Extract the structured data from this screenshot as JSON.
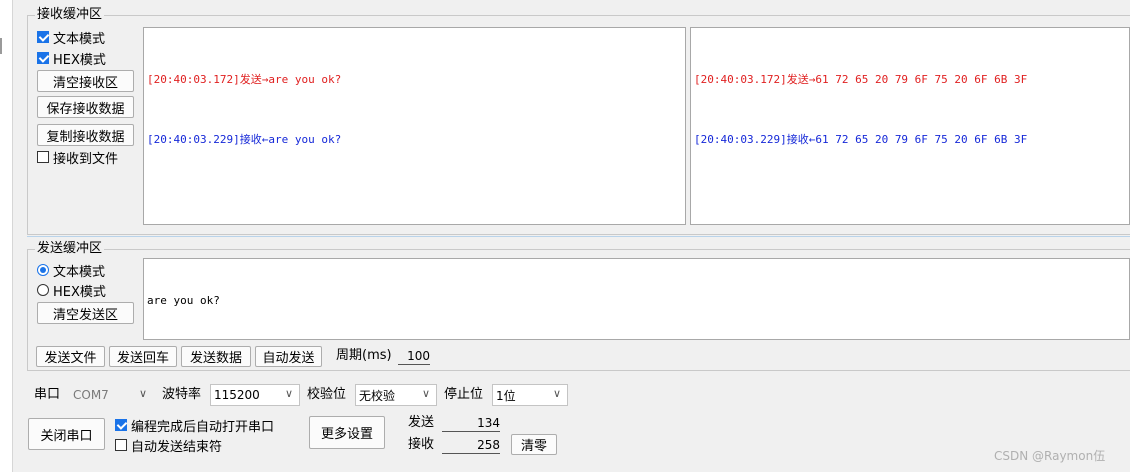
{
  "receive": {
    "group_title": "接收缓冲区",
    "text_mode": "文本模式",
    "hex_mode": "HEX模式",
    "clear_button": "清空接收区",
    "save_button": "保存接收数据",
    "copy_button": "复制接收数据",
    "to_file": "接收到文件",
    "text_lines": [
      {
        "time": "[20:40:03.172]",
        "dir": "发送→",
        "data": "are you ok?"
      },
      {
        "time": "[20:40:03.229]",
        "dir": "接收←",
        "data": "are you ok?"
      }
    ],
    "hex_lines": [
      {
        "time": "[20:40:03.172]",
        "dir": "发送→",
        "data": "61 72 65 20 79 6F 75 20 6F 6B 3F"
      },
      {
        "time": "[20:40:03.229]",
        "dir": "接收←",
        "data": "61 72 65 20 79 6F 75 20 6F 6B 3F"
      }
    ]
  },
  "send": {
    "group_title": "发送缓冲区",
    "text_mode": "文本模式",
    "hex_mode": "HEX模式",
    "clear_button": "清空发送区",
    "content": "are you ok?",
    "send_file_button": "发送文件",
    "send_enter_button": "发送回车",
    "send_data_button": "发送数据",
    "auto_send_button": "自动发送",
    "period_label": "周期(ms)",
    "period_value": "100"
  },
  "port": {
    "port_label": "串口",
    "port_value": "COM7",
    "baud_label": "波特率",
    "baud_value": "115200",
    "parity_label": "校验位",
    "parity_value": "无校验",
    "stop_label": "停止位",
    "stop_value": "1位",
    "close_button": "关闭串口",
    "auto_open": "编程完成后自动打开串口",
    "auto_send_end": "自动发送结束符",
    "more_settings": "更多设置",
    "sent_label": "发送",
    "sent_count": "134",
    "recv_label": "接收",
    "recv_count": "258",
    "clear_count_button": "清零"
  },
  "watermark": "CSDN @Raymon伍",
  "colors": {
    "send_text": "#e02020",
    "recv_text": "#1528d8",
    "accent": "#1a73e8"
  }
}
